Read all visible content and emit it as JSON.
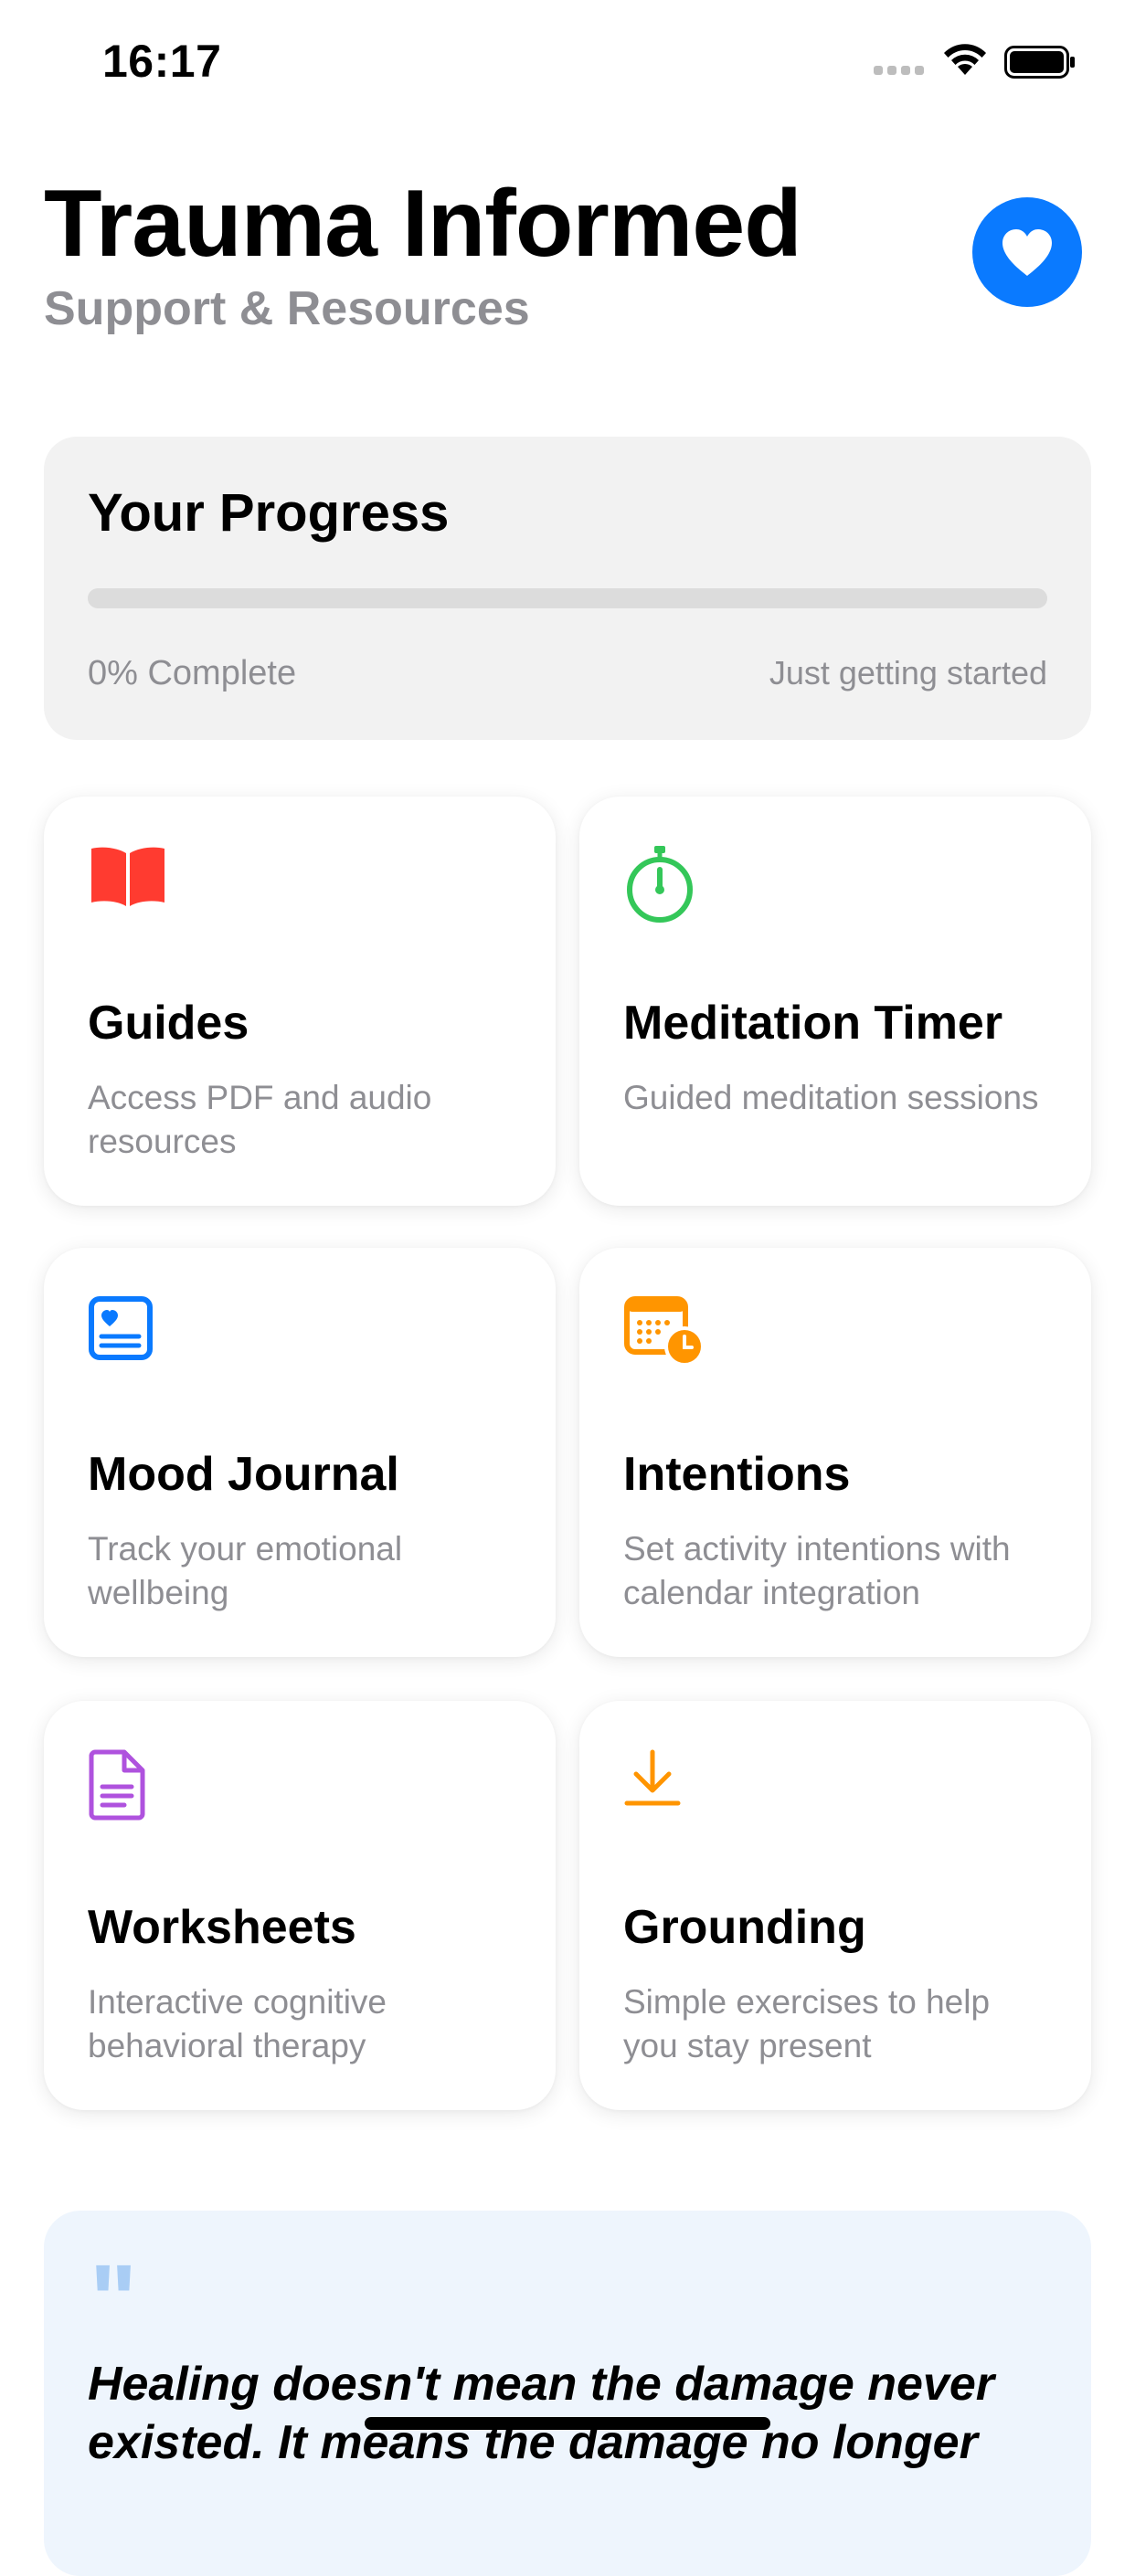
{
  "status_bar": {
    "time": "16:17"
  },
  "header": {
    "title": "Trauma Informed",
    "subtitle": "Support & Resources",
    "favorite_icon": "heart-icon",
    "accent_color": "#0a7aff"
  },
  "progress": {
    "title": "Your Progress",
    "percent": 0,
    "complete_label": "0% Complete",
    "status_label": "Just getting started"
  },
  "cards": [
    {
      "title": "Guides",
      "description": "Access PDF and audio resources",
      "icon": "book-icon",
      "color": "#ff3b30"
    },
    {
      "title": "Meditation Timer",
      "description": "Guided meditation sessions",
      "icon": "timer-icon",
      "color": "#34c759"
    },
    {
      "title": "Mood Journal",
      "description": "Track your emotional wellbeing",
      "icon": "journal-icon",
      "color": "#0a7aff"
    },
    {
      "title": "Intentions",
      "description": "Set activity intentions with calendar integration",
      "icon": "calendar-clock-icon",
      "color": "#ff9500"
    },
    {
      "title": "Worksheets",
      "description": "Interactive cognitive behavioral therapy",
      "icon": "document-icon",
      "color": "#af52de"
    },
    {
      "title": "Grounding",
      "description": "Simple exercises to help you stay present",
      "icon": "download-icon",
      "color": "#ff9500"
    }
  ],
  "quote": {
    "mark": "\"",
    "text": "Healing doesn't mean the damage never existed. It means the damage no longer"
  }
}
